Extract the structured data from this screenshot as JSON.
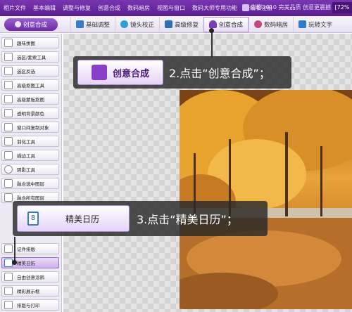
{
  "menu": {
    "items": [
      "相片文件",
      "基本编辑",
      "调整与修复",
      "创意合成",
      "数码暗房",
      "视图与窗口",
      "数码大师专用功能",
      "升级和注册"
    ],
    "app_title": "彩影2010 完美品质 创意更震撼",
    "zoom": "[72%"
  },
  "toolbar": {
    "active_button": "创意合成",
    "tabs": [
      {
        "label": "基础调整",
        "icon": "adjust-icon",
        "color": "#3a7bc8"
      },
      {
        "label": "镜头校正",
        "icon": "lens-icon",
        "color": "#2a9fd8"
      },
      {
        "label": "高级修复",
        "icon": "repair-icon",
        "color": "#2e6fb5"
      },
      {
        "label": "创意合成",
        "icon": "person-icon",
        "color": "#7b3cb8"
      },
      {
        "label": "数码暗房",
        "icon": "darkroom-icon",
        "color": "#c8467e"
      },
      {
        "label": "玩转文字",
        "icon": "text-icon",
        "color": "#2a7fc8"
      }
    ]
  },
  "sidebar": {
    "items": [
      {
        "label": "趣味拼图"
      },
      {
        "label": "选区/套索工具"
      },
      {
        "label": "选区反选"
      },
      {
        "label": "高级抠图工具"
      },
      {
        "label": "高级蒙板抠图"
      },
      {
        "label": "透明背景颜色"
      },
      {
        "label": "窗口间复制对象"
      },
      {
        "label": "羽化工具"
      },
      {
        "label": "描边工具"
      },
      {
        "label": "阴影工具"
      },
      {
        "label": "融合选中图层"
      },
      {
        "label": "融合所有图层"
      },
      {
        "label": "证件排版"
      },
      {
        "label": "精美日历"
      },
      {
        "label": "自由创意涂鸦"
      },
      {
        "label": "精彩展示框"
      },
      {
        "label": "排版与打印"
      }
    ]
  },
  "callouts": {
    "step2": {
      "button": "创意合成",
      "text": "2.点击“创意合成”；"
    },
    "step3": {
      "button": "精美日历",
      "text": "3.点击“精美日历”；"
    }
  }
}
